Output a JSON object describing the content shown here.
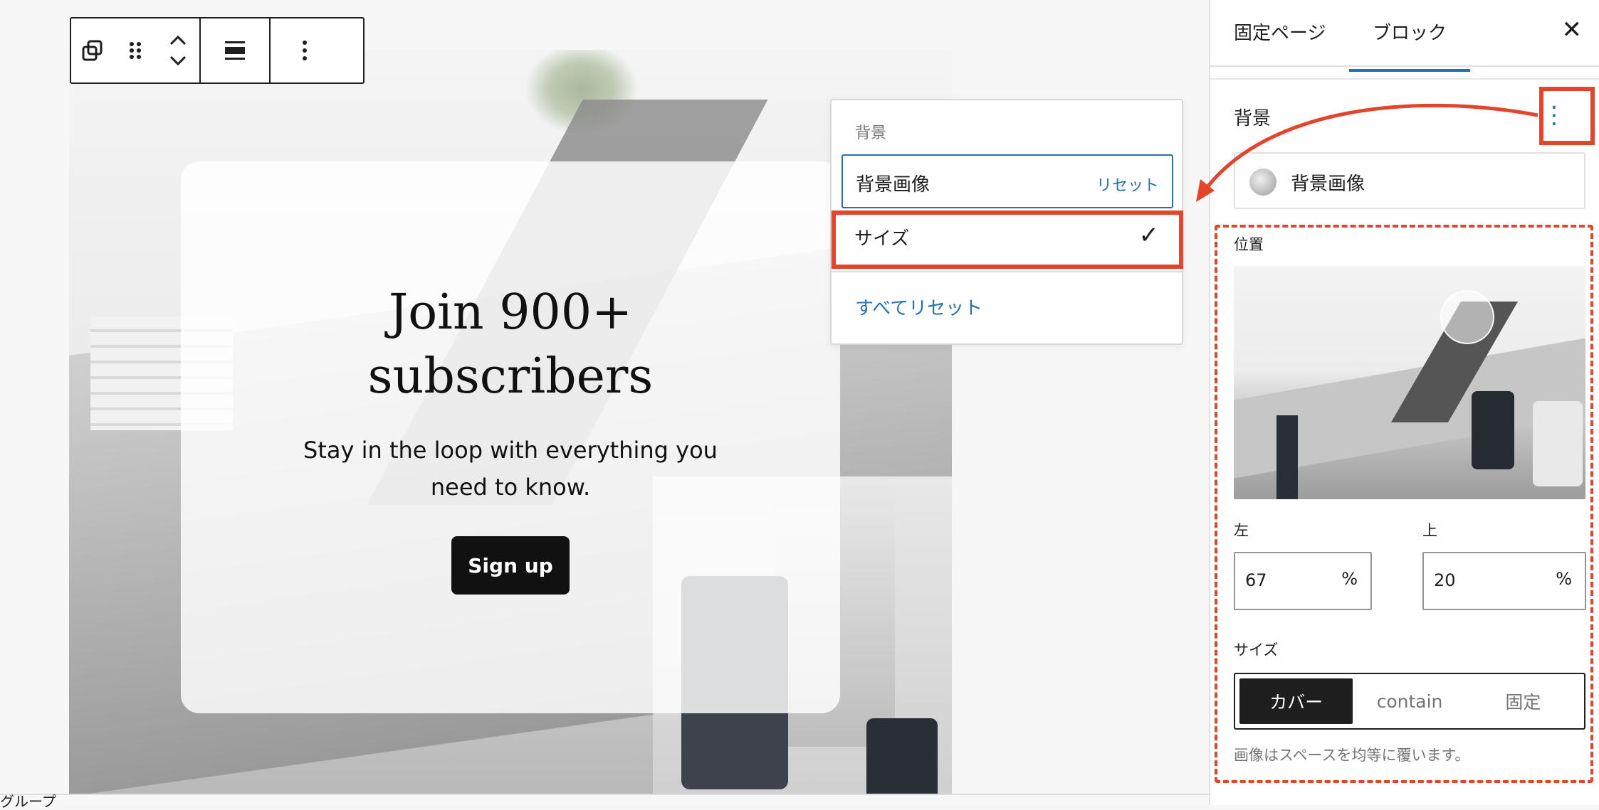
{
  "card": {
    "heading_line1": "Join 900+",
    "heading_line2": "subscribers",
    "body_line1": "Stay in the loop with everything you",
    "body_line2": "need to know.",
    "button": "Sign up"
  },
  "toolbar": {
    "icons": [
      "duplicate-icon",
      "drag-handle-icon",
      "move-up-down-icon",
      "align-icon",
      "more-options-icon"
    ]
  },
  "popover": {
    "header": "背景",
    "items": [
      {
        "label": "背景画像",
        "action": "リセット"
      },
      {
        "label": "サイズ",
        "check": "✓"
      }
    ],
    "reset_all": "すべてリセット"
  },
  "sidebar": {
    "tabs": [
      "固定ページ",
      "ブロック"
    ],
    "active_tab": "ブロック",
    "close": "✕",
    "section_title": "背景",
    "kebab": "⋮",
    "bg_image_label": "背景画像",
    "position_label": "位置",
    "left_label": "左",
    "top_label": "上",
    "left_value": "67",
    "top_value": "20",
    "unit": "%",
    "size_label": "サイズ",
    "size_options": [
      "カバー",
      "contain",
      "固定"
    ],
    "size_selected": "カバー",
    "help_text": "画像はスペースを均等に覆います。"
  },
  "footer": {
    "breadcrumb": "グループ"
  },
  "colors": {
    "accent": "#2271b1",
    "annotation": "#e4442b"
  }
}
